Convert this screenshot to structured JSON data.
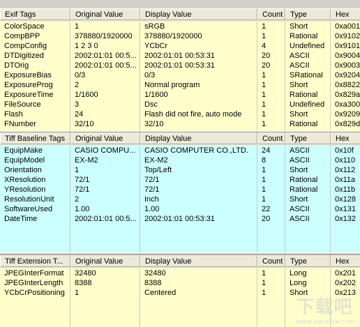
{
  "columns": [
    "Original Value",
    "Display Value",
    "Count",
    "Type",
    "Hex"
  ],
  "exif": {
    "title": "Exif Tags",
    "rows": [
      {
        "tag": "ColorSpace",
        "orig": "1",
        "disp": "sRGB",
        "count": "1",
        "type": "Short",
        "hex": "0xa001"
      },
      {
        "tag": "CompBPP",
        "orig": "378880/1920000",
        "disp": "378880/1920000",
        "count": "1",
        "type": "Rational",
        "hex": "0x9102"
      },
      {
        "tag": "CompConfig",
        "orig": "1 2 3 0",
        "disp": "YCbCr",
        "count": "4",
        "type": "Undefined",
        "hex": "0x9101"
      },
      {
        "tag": "DTDigitized",
        "orig": "2002:01:01 00:5...",
        "disp": "2002:01:01 00:53:31",
        "count": "20",
        "type": "ASCII",
        "hex": "0x9004"
      },
      {
        "tag": "DTOrig",
        "orig": "2002:01:01 00:5...",
        "disp": "2002:01:01 00:53:31",
        "count": "20",
        "type": "ASCII",
        "hex": "0x9003"
      },
      {
        "tag": "ExposureBias",
        "orig": "0/3",
        "disp": "0/3",
        "count": "1",
        "type": "SRational",
        "hex": "0x9204"
      },
      {
        "tag": "ExposureProg",
        "orig": "2",
        "disp": "Normal program",
        "count": "1",
        "type": "Short",
        "hex": "0x8822"
      },
      {
        "tag": "ExposureTime",
        "orig": "1/1600",
        "disp": "1/1600",
        "count": "1",
        "type": "Rational",
        "hex": "0x829a"
      },
      {
        "tag": "FileSource",
        "orig": "3",
        "disp": "Dsc",
        "count": "1",
        "type": "Undefined",
        "hex": "0xa300"
      },
      {
        "tag": "Flash",
        "orig": "24",
        "disp": "Flash did not fire, auto mode",
        "count": "1",
        "type": "Short",
        "hex": "0x9209"
      },
      {
        "tag": "FNumber",
        "orig": "32/10",
        "disp": "32/10",
        "count": "1",
        "type": "Rational",
        "hex": "0x829d"
      }
    ]
  },
  "tiff": {
    "title": "Tiff Baseline Tags",
    "rows": [
      {
        "tag": "EquipMake",
        "orig": "CASIO COMPU...",
        "disp": "CASIO COMPUTER CO.,LTD.",
        "count": "24",
        "type": "ASCII",
        "hex": "0x10f"
      },
      {
        "tag": "EquipModel",
        "orig": "EX-M2",
        "disp": "EX-M2",
        "count": "8",
        "type": "ASCII",
        "hex": "0x110"
      },
      {
        "tag": "Orientation",
        "orig": "1",
        "disp": "Top/Left",
        "count": "1",
        "type": "Short",
        "hex": "0x112"
      },
      {
        "tag": "XResolution",
        "orig": "72/1",
        "disp": "72/1",
        "count": "1",
        "type": "Rational",
        "hex": "0x11a"
      },
      {
        "tag": "YResolution",
        "orig": "72/1",
        "disp": "72/1",
        "count": "1",
        "type": "Rational",
        "hex": "0x11b"
      },
      {
        "tag": "ResolutionUnit",
        "orig": "2",
        "disp": "Inch",
        "count": "1",
        "type": "Short",
        "hex": "0x128"
      },
      {
        "tag": "SoftwareUsed",
        "orig": "1.00",
        "disp": "1.00",
        "count": "22",
        "type": "ASCII",
        "hex": "0x131"
      },
      {
        "tag": "DateTime",
        "orig": "2002:01:01 00:5...",
        "disp": "2002:01:01 00:53:31",
        "count": "20",
        "type": "ASCII",
        "hex": "0x132"
      }
    ]
  },
  "ext": {
    "title": "Tiff Extension T...",
    "rows": [
      {
        "tag": "JPEGInterFormat",
        "orig": "32480",
        "disp": "32480",
        "count": "1",
        "type": "Long",
        "hex": "0x201"
      },
      {
        "tag": "JPEGInterLength",
        "orig": "8388",
        "disp": "8388",
        "count": "1",
        "type": "Long",
        "hex": "0x202"
      },
      {
        "tag": "YCbCrPositioning",
        "orig": "1",
        "disp": "Centered",
        "count": "1",
        "type": "Short",
        "hex": "0x213"
      }
    ]
  },
  "watermark": {
    "logo": "下载吧",
    "url": "www.xiazaiba.com"
  }
}
